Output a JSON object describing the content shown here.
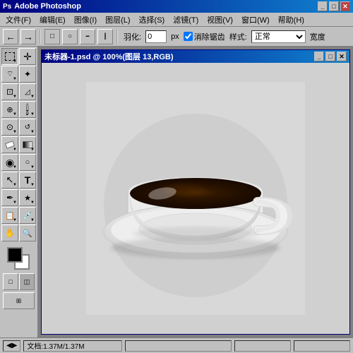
{
  "app": {
    "title": "Adobe Photoshop",
    "name": "Photoshop"
  },
  "menu": {
    "items": [
      {
        "label": "文件(F)"
      },
      {
        "label": "编辑(E)"
      },
      {
        "label": "图像(I)"
      },
      {
        "label": "图层(L)"
      },
      {
        "label": "选择(S)"
      },
      {
        "label": "滤镜(T)"
      },
      {
        "label": "视图(V)"
      },
      {
        "label": "窗口(W)"
      },
      {
        "label": "帮助(H)"
      }
    ]
  },
  "toolbar": {
    "feather_label": "羽化:",
    "feather_value": "0",
    "feather_unit": "px",
    "antialias_label": "消除锯齿",
    "style_label": "样式:",
    "style_value": "正常",
    "width_label": "宽度"
  },
  "document": {
    "title": "未标器-1.psd @ 100%(图层 13,RGB)"
  },
  "tools": [
    {
      "name": "rectangular-marquee",
      "icon": "⬜",
      "active": true
    },
    {
      "name": "move",
      "icon": "✛"
    },
    {
      "name": "lasso",
      "icon": "⌀"
    },
    {
      "name": "magic-wand",
      "icon": "✦"
    },
    {
      "name": "crop",
      "icon": "⊡"
    },
    {
      "name": "slice",
      "icon": "⊿"
    },
    {
      "name": "healing-brush",
      "icon": "⊕"
    },
    {
      "name": "brush",
      "icon": "🖌"
    },
    {
      "name": "clone-stamp",
      "icon": "⊙"
    },
    {
      "name": "history-brush",
      "icon": "↩"
    },
    {
      "name": "eraser",
      "icon": "◻"
    },
    {
      "name": "gradient",
      "icon": "▤"
    },
    {
      "name": "blur",
      "icon": "◉"
    },
    {
      "name": "dodge",
      "icon": "○"
    },
    {
      "name": "path-selection",
      "icon": "↖"
    },
    {
      "name": "text",
      "icon": "T"
    },
    {
      "name": "pen",
      "icon": "✒"
    },
    {
      "name": "custom-shape",
      "icon": "★"
    },
    {
      "name": "notes",
      "icon": "📝"
    },
    {
      "name": "eyedropper",
      "icon": "⊿"
    },
    {
      "name": "hand",
      "icon": "✋"
    },
    {
      "name": "zoom",
      "icon": "🔍"
    }
  ],
  "colors": {
    "foreground": "#000000",
    "background": "#ffffff",
    "accent_blue": "#000080",
    "toolbar_bg": "#c0c0c0",
    "canvas_bg": "#808080",
    "doc_bg": "#d4d4d4"
  },
  "status": {
    "doc_size": "文档:1.37M/1.37M",
    "tool_info": ""
  }
}
